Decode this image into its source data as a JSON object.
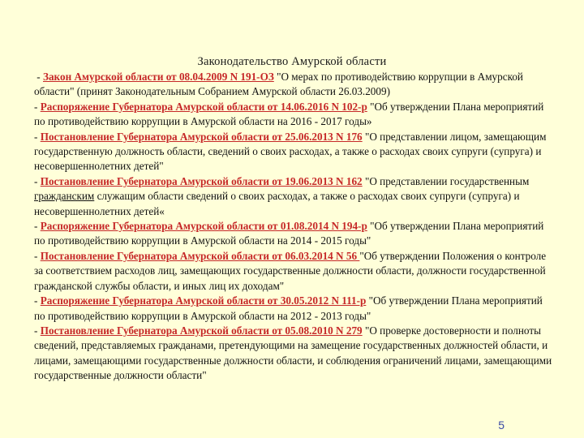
{
  "slide": {
    "title": "Законодательство Амурской области",
    "page_number": "5",
    "colors": {
      "background": "#ffffd9",
      "link": "#c62828",
      "page_number": "#3a4aa5"
    }
  },
  "items": [
    {
      "dash": " - ",
      "link": "Закон Амурской области от 08.04.2009 N 191-ОЗ",
      "desc": " \"О мерах по противодействию коррупции в Амурской области\" (принят Законодательным Собранием Амурской области 26.03.2009)"
    },
    {
      "dash": "- ",
      "link": "Распоряжение Губернатора Амурской области от 14.06.2016 N 102-р",
      "desc": " \"Об утверждении Плана мероприятий по противодействию коррупции в Амурской области на 2016 - 2017 годы»"
    },
    {
      "dash": "- ",
      "link": "Постановление Губернатора Амурской области от 25.06.2013 N 176",
      "desc": " \"О представлении лицом, замещающим государственную должность области, сведений о своих расходах, а также о расходах своих супруги (супруга) и несовершеннолетних детей\""
    },
    {
      "dash": "- ",
      "link": "Постановление Губернатора Амурской области от 19.06.2013 N 162",
      "desc_before": "  \"О представлении государственным ",
      "desc_underlined": "гражданским",
      "desc_after": " служащим области сведений о своих расходах, а также о расходах своих супруги (супруга) и несовершеннолетних детей«"
    },
    {
      "dash": "- ",
      "link": "Распоряжение Губернатора Амурской области от 01.08.2014 N 194-р",
      "desc": " \"Об утверждении Плана мероприятий по противодействию коррупции в Амурской области на 2014 - 2015 годы\""
    },
    {
      "dash": "- ",
      "link": "Постановление Губернатора Амурской области от 06.03.2014 N 56 ",
      "desc": "\"Об утверждении Положения о контроле за соответствием расходов лиц, замещающих государственные должности области, должности государственной гражданской службы области, и иных лиц их доходам\""
    },
    {
      "dash": "- ",
      "link": "Распоряжение Губернатора Амурской области от 30.05.2012 N 111-р",
      "desc": " \"Об утверждении Плана мероприятий по противодействию коррупции в Амурской области на 2012 - 2013 годы\""
    },
    {
      "dash": "- ",
      "link": "Постановление Губернатора Амурской области от 05.08.2010 N 279",
      "desc": "  \"О проверке достоверности и полноты сведений, представляемых гражданами, претендующими на замещение государственных должностей области, и лицами, замещающими государственные должности области, и соблюдения ограничений лицами, замещающими государственные должности области\""
    }
  ]
}
